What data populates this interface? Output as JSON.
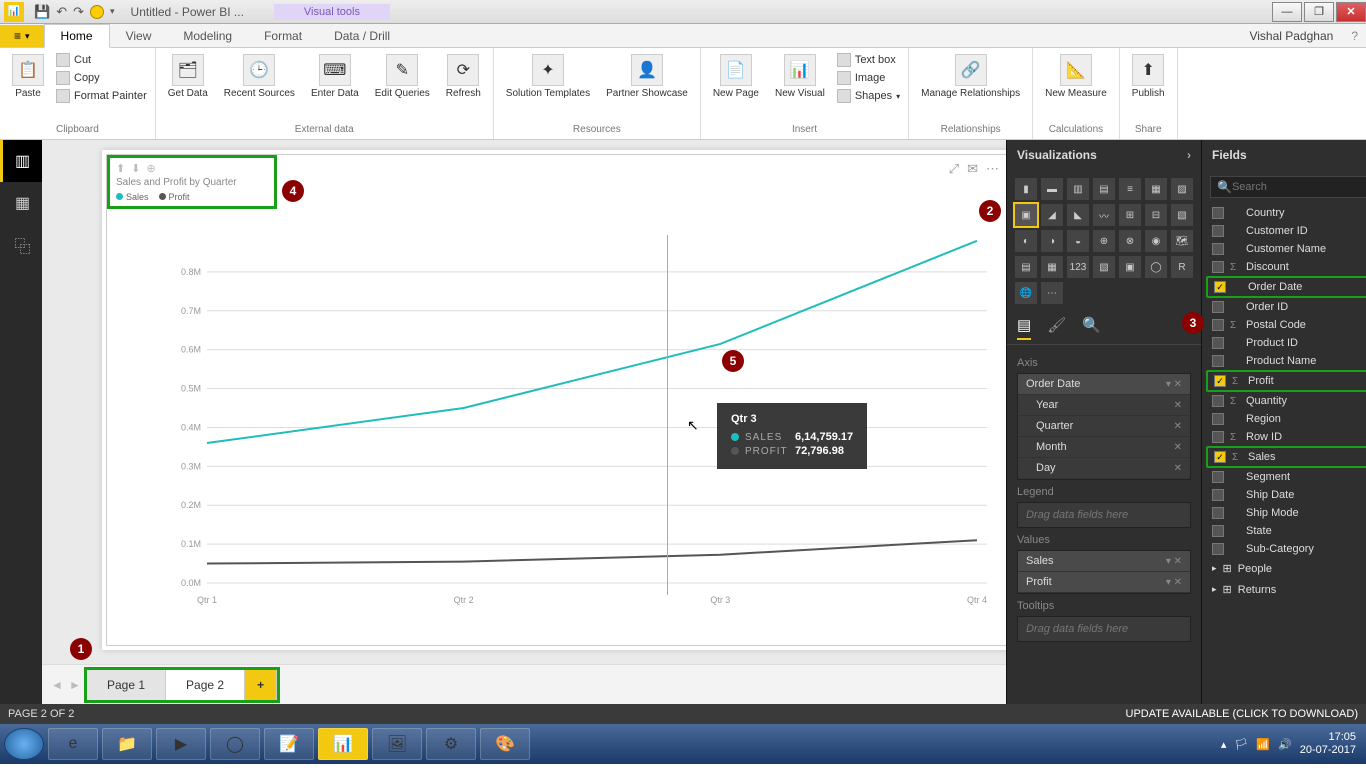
{
  "titlebar": {
    "doc_title": "Untitled - Power BI ...",
    "visual_tools": "Visual tools"
  },
  "user_name": "Vishal Padghan",
  "ribbon_tabs": {
    "file": "File",
    "home": "Home",
    "view": "View",
    "modeling": "Modeling",
    "format": "Format",
    "datadrill": "Data / Drill"
  },
  "ribbon": {
    "clipboard": {
      "paste": "Paste",
      "cut": "Cut",
      "copy": "Copy",
      "fmt": "Format Painter",
      "label": "Clipboard"
    },
    "external": {
      "getdata": "Get\nData",
      "recent": "Recent\nSources",
      "enter": "Enter\nData",
      "edit": "Edit\nQueries",
      "refresh": "Refresh",
      "label": "External data"
    },
    "resources": {
      "sol": "Solution\nTemplates",
      "partner": "Partner\nShowcase",
      "label": "Resources"
    },
    "insert": {
      "newpage": "New\nPage",
      "newvis": "New\nVisual",
      "textbox": "Text box",
      "image": "Image",
      "shapes": "Shapes",
      "label": "Insert"
    },
    "rel": {
      "manage": "Manage\nRelationships",
      "label": "Relationships"
    },
    "calc": {
      "measure": "New\nMeasure",
      "label": "Calculations"
    },
    "share": {
      "publish": "Publish",
      "label": "Share"
    }
  },
  "chart": {
    "title": "Sales and Profit by Quarter",
    "legend": [
      {
        "name": "Sales",
        "color": "#1fbdbb"
      },
      {
        "name": "Profit",
        "color": "#555555"
      }
    ],
    "tooltip": {
      "title": "Qtr 3",
      "rows": [
        {
          "key": "SALES",
          "value": "6,14,759.17",
          "color": "#1fbdbb"
        },
        {
          "key": "PROFIT",
          "value": "72,796.98",
          "color": "#555555"
        }
      ]
    }
  },
  "chart_data": {
    "type": "line",
    "categories": [
      "Qtr 1",
      "Qtr 2",
      "Qtr 3",
      "Qtr 4"
    ],
    "series": [
      {
        "name": "Sales",
        "color": "#1fbdbb",
        "values": [
          360000,
          450000,
          614759.17,
          880000
        ]
      },
      {
        "name": "Profit",
        "color": "#555555",
        "values": [
          50000,
          55000,
          72796.98,
          110000
        ]
      }
    ],
    "yticks": [
      "0.0M",
      "0.1M",
      "0.2M",
      "0.3M",
      "0.4M",
      "0.5M",
      "0.6M",
      "0.7M",
      "0.8M"
    ],
    "ylim": [
      0,
      900000
    ],
    "title": "Sales and Profit by Quarter"
  },
  "pages": {
    "p1": "Page 1",
    "p2": "Page 2"
  },
  "viz_panel": {
    "title": "Visualizations",
    "axis": "Axis",
    "legend": "Legend",
    "values": "Values",
    "tooltips": "Tooltips",
    "placeholder": "Drag data fields here",
    "axis_items": {
      "root": "Order Date",
      "year": "Year",
      "quarter": "Quarter",
      "month": "Month",
      "day": "Day"
    },
    "value_items": {
      "sales": "Sales",
      "profit": "Profit"
    }
  },
  "fields_panel": {
    "title": "Fields",
    "search_ph": "Search",
    "items": [
      {
        "k": "country",
        "label": "Country",
        "checked": false,
        "sigma": false,
        "hl": false
      },
      {
        "k": "custid",
        "label": "Customer ID",
        "checked": false,
        "sigma": false,
        "hl": false
      },
      {
        "k": "custname",
        "label": "Customer Name",
        "checked": false,
        "sigma": false,
        "hl": false
      },
      {
        "k": "discount",
        "label": "Discount",
        "checked": false,
        "sigma": true,
        "hl": false
      },
      {
        "k": "orderdate",
        "label": "Order Date",
        "checked": true,
        "sigma": false,
        "hl": true
      },
      {
        "k": "orderid",
        "label": "Order ID",
        "checked": false,
        "sigma": false,
        "hl": false
      },
      {
        "k": "postal",
        "label": "Postal Code",
        "checked": false,
        "sigma": true,
        "hl": false
      },
      {
        "k": "prodid",
        "label": "Product ID",
        "checked": false,
        "sigma": false,
        "hl": false
      },
      {
        "k": "prodname",
        "label": "Product Name",
        "checked": false,
        "sigma": false,
        "hl": false
      },
      {
        "k": "profit",
        "label": "Profit",
        "checked": true,
        "sigma": true,
        "hl": true
      },
      {
        "k": "qty",
        "label": "Quantity",
        "checked": false,
        "sigma": true,
        "hl": false
      },
      {
        "k": "region",
        "label": "Region",
        "checked": false,
        "sigma": false,
        "hl": false
      },
      {
        "k": "rowid",
        "label": "Row ID",
        "checked": false,
        "sigma": true,
        "hl": false
      },
      {
        "k": "sales",
        "label": "Sales",
        "checked": true,
        "sigma": true,
        "hl": true
      },
      {
        "k": "segment",
        "label": "Segment",
        "checked": false,
        "sigma": false,
        "hl": false
      },
      {
        "k": "shipdate",
        "label": "Ship Date",
        "checked": false,
        "sigma": false,
        "hl": false
      },
      {
        "k": "shipmode",
        "label": "Ship Mode",
        "checked": false,
        "sigma": false,
        "hl": false
      },
      {
        "k": "state",
        "label": "State",
        "checked": false,
        "sigma": false,
        "hl": false
      },
      {
        "k": "subcat",
        "label": "Sub-Category",
        "checked": false,
        "sigma": false,
        "hl": false
      }
    ],
    "tables": {
      "people": "People",
      "returns": "Returns"
    }
  },
  "statusbar": {
    "page": "PAGE 2 OF 2",
    "update": "UPDATE AVAILABLE (CLICK TO DOWNLOAD)"
  },
  "taskbar": {
    "time": "17:05",
    "date": "20-07-2017"
  },
  "badges": {
    "b1": "1",
    "b2": "2",
    "b3": "3",
    "b4": "4",
    "b5": "5"
  }
}
